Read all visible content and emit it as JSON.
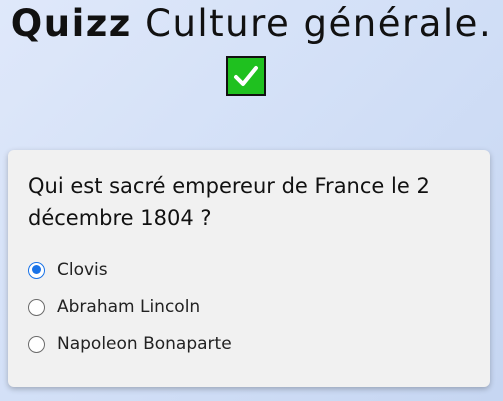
{
  "header": {
    "title_bold": "Quizz",
    "title_rest": " Culture générale."
  },
  "check_icon": "checkmark-icon",
  "accent_colors": {
    "check_background": "#1fc11f",
    "radio_selected": "#1a73e8"
  },
  "quiz": {
    "question": "Qui est sacré empereur de France le 2 décembre 1804 ?",
    "options": [
      {
        "label": "Clovis",
        "selected": true
      },
      {
        "label": "Abraham Lincoln",
        "selected": false
      },
      {
        "label": "Napoleon Bonaparte",
        "selected": false
      }
    ]
  }
}
